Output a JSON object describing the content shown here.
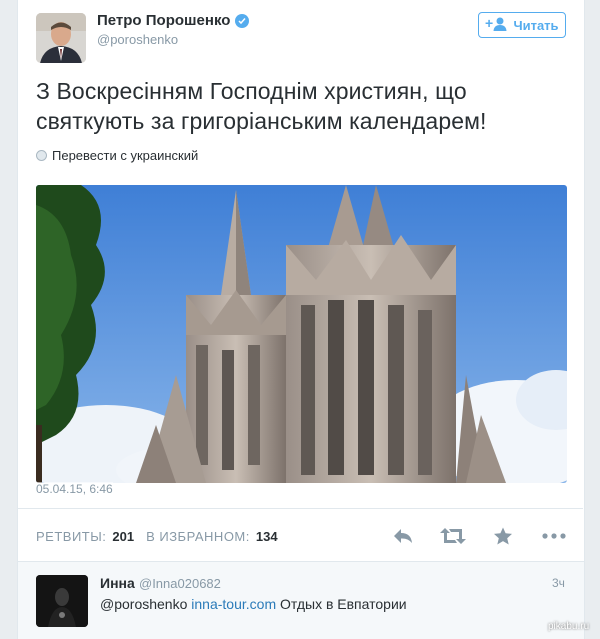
{
  "tweet": {
    "author_name": "Петро Порошенко",
    "author_handle": "@poroshenko",
    "follow_label": "Читать",
    "text_line1": "З Воскресінням Господнім християн, що",
    "text_line2": "святкують за григоріанським календарем!",
    "translate_label": "Перевести с украинский",
    "timestamp": "05.04.15, 6:46",
    "retweets_label": "РЕТВИТЫ:",
    "retweets_count": "201",
    "favorites_label": "В ИЗБРАННОМ:",
    "favorites_count": "134",
    "icons": [
      "reply-icon",
      "retweet-icon",
      "favorite-icon",
      "more-icon",
      "verified-icon",
      "follow-user-icon",
      "globe-icon"
    ]
  },
  "reply": {
    "author_name": "Инна",
    "author_handle": "@Inna020682",
    "time": "3ч",
    "mention": "@poroshenko",
    "link": "inna-tour.com",
    "text": "Отдых в Евпатории"
  },
  "watermark": "pikabu.ru",
  "colors": {
    "accent": "#55acee",
    "link": "#2b7bb9",
    "muted": "#8899a6",
    "text": "#292f33",
    "background": "#e9edf0"
  }
}
